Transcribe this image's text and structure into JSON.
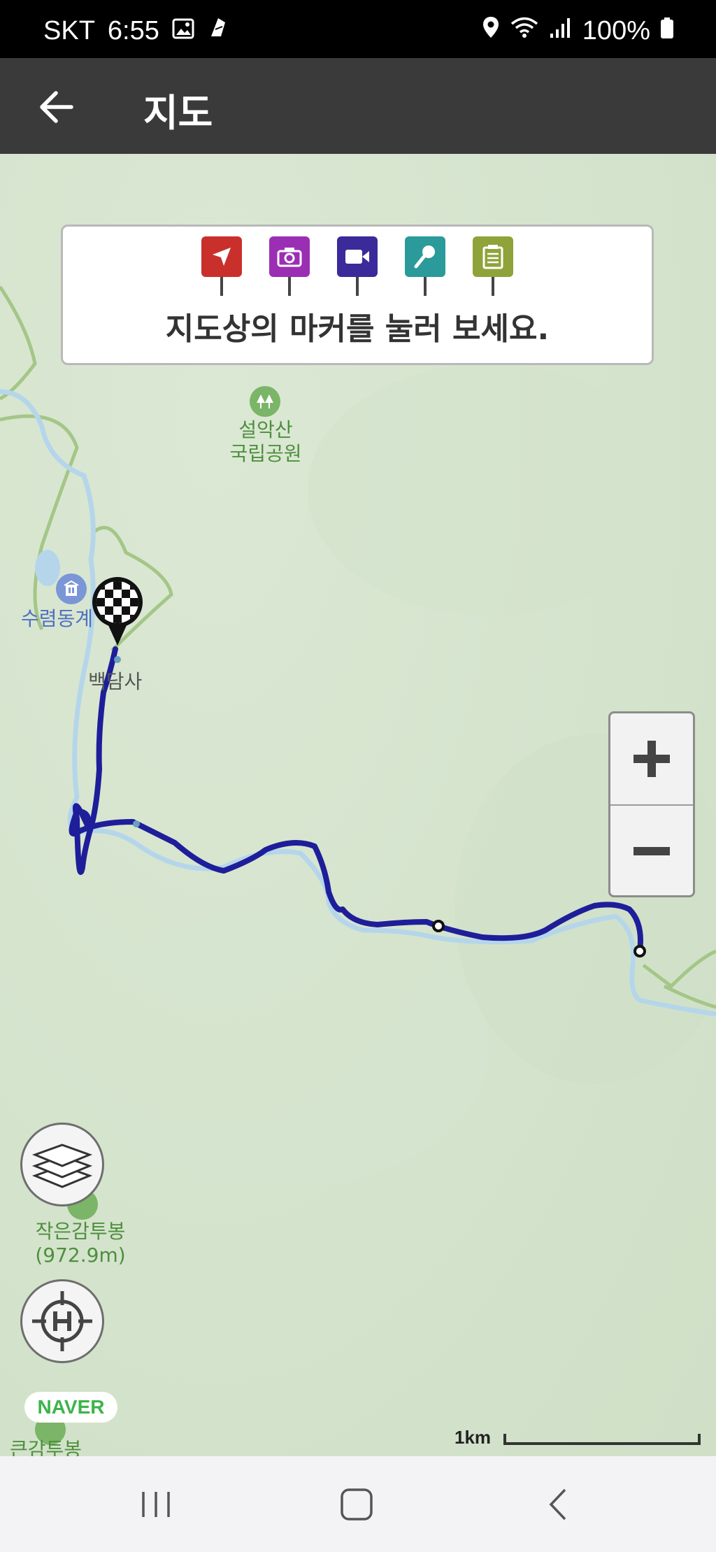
{
  "status": {
    "carrier": "SKT",
    "time": "6:55",
    "battery": "100%",
    "icons": [
      "image-icon",
      "app-icon",
      "location-icon",
      "wifi-icon",
      "signal-icon",
      "battery-icon"
    ]
  },
  "app_bar": {
    "title": "지도",
    "back_icon": "arrow-left-icon"
  },
  "banner": {
    "markers": [
      {
        "name": "location",
        "color": "#c9302c",
        "icon": "navigation-icon"
      },
      {
        "name": "photo",
        "color": "#9b2fb4",
        "icon": "camera-icon"
      },
      {
        "name": "video",
        "color": "#3a2a9a",
        "icon": "video-icon"
      },
      {
        "name": "audio",
        "color": "#2a9a9a",
        "icon": "microphone-icon"
      },
      {
        "name": "memo",
        "color": "#8ea33a",
        "icon": "note-icon"
      }
    ],
    "text": "지도상의 마커를 눌러 보세요."
  },
  "map": {
    "labels": {
      "park": "설악산\n국립공원",
      "park_line1": "설악산",
      "park_line2": "국립공원",
      "shelter": "수렴동계",
      "temple": "백담사",
      "peak1_line1": "작은감투봉",
      "peak1_line2": "(972.9m)",
      "peak2": "큰감투봉"
    },
    "scale_label": "1km",
    "naver": "NAVER",
    "route_color": "#1e1e9a"
  },
  "zoom": {
    "plus": "+",
    "minus": "−"
  },
  "nav": {
    "icons": [
      "recent-apps-icon",
      "home-icon",
      "back-icon"
    ]
  }
}
